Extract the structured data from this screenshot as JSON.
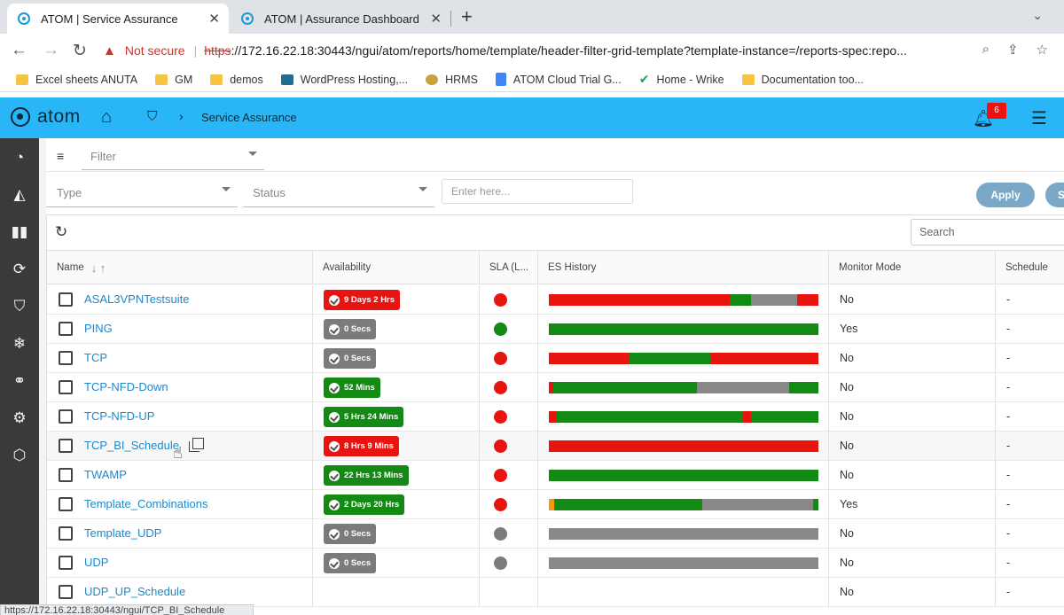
{
  "browser": {
    "tabs": [
      {
        "title": "ATOM | Service Assurance",
        "active": true
      },
      {
        "title": "ATOM | Assurance Dashboard",
        "active": false
      }
    ],
    "new_tab_label": "+",
    "close_glyph": "✕",
    "not_secure_label": "Not secure",
    "url_scheme": "https",
    "url_rest": "://172.16.22.18:30443/ngui/atom/reports/home/template/header-filter-grid-template?template-instance=/reports-spec:repo...",
    "bookmarks": [
      {
        "label": "Excel sheets ANUTA",
        "icon": "folder-icon"
      },
      {
        "label": "GM",
        "icon": "folder-icon"
      },
      {
        "label": "demos",
        "icon": "folder-icon"
      },
      {
        "label": "WordPress Hosting,...",
        "icon": "image-icon"
      },
      {
        "label": "HRMS",
        "icon": "bee-icon"
      },
      {
        "label": "ATOM Cloud Trial G...",
        "icon": "doc-icon"
      },
      {
        "label": "Home - Wrike",
        "icon": "wrike-icon"
      },
      {
        "label": "Documentation too...",
        "icon": "folder-icon"
      }
    ],
    "status_url": "https://172.16.22.18:30443/ngui/TCP_BI_Schedule"
  },
  "app": {
    "logo_text": "atom",
    "breadcrumb_title": "Service Assurance",
    "notification_count": "6",
    "accent_color": "#29b6f6"
  },
  "filters": {
    "filter_placeholder": "Filter",
    "type_placeholder": "Type",
    "status_placeholder": "Status",
    "text_placeholder": "Enter here...",
    "apply_label": "Apply",
    "second_button_label": "S",
    "search_placeholder": "Search"
  },
  "grid": {
    "columns": [
      "Name",
      "Availability",
      "SLA (L...",
      "ES History",
      "Monitor Mode",
      "Schedule"
    ],
    "rows": [
      {
        "name": "ASAL3VPNTestsuite",
        "availability": "9 Days 2 Hrs",
        "avail_color": "#e8140f",
        "sla_color": "#e8140f",
        "es": [
          [
            "#e8140f",
            67
          ],
          [
            "#138a13",
            8
          ],
          [
            "#888888",
            17
          ],
          [
            "#e8140f",
            8
          ]
        ],
        "monitor": "No",
        "schedule": "-"
      },
      {
        "name": "PING",
        "availability": "0 Secs",
        "avail_color": "#7b7b7b",
        "sla_color": "#138a13",
        "es": [
          [
            "#138a13",
            100
          ]
        ],
        "monitor": "Yes",
        "schedule": "-"
      },
      {
        "name": "TCP",
        "availability": "0 Secs",
        "avail_color": "#7b7b7b",
        "sla_color": "#e8140f",
        "es": [
          [
            "#e8140f",
            30
          ],
          [
            "#138a13",
            30
          ],
          [
            "#e8140f",
            40
          ]
        ],
        "monitor": "No",
        "schedule": "-"
      },
      {
        "name": "TCP-NFD-Down",
        "availability": "52 Mins",
        "avail_color": "#138a13",
        "sla_color": "#e8140f",
        "es": [
          [
            "#e8140f",
            1.5
          ],
          [
            "#138a13",
            53.5
          ],
          [
            "#888888",
            34
          ],
          [
            "#138a13",
            11
          ]
        ],
        "monitor": "No",
        "schedule": "-"
      },
      {
        "name": "TCP-NFD-UP",
        "availability": "5 Hrs 24 Mins",
        "avail_color": "#138a13",
        "sla_color": "#e8140f",
        "es": [
          [
            "#e8140f",
            3
          ],
          [
            "#138a13",
            69
          ],
          [
            "#e8140f",
            3
          ],
          [
            "#138a13",
            25
          ]
        ],
        "monitor": "No",
        "schedule": "-"
      },
      {
        "name": "TCP_BI_Schedule",
        "availability": "8 Hrs 9 Mins",
        "avail_color": "#e8140f",
        "sla_color": "#e8140f",
        "es": [
          [
            "#e8140f",
            100
          ]
        ],
        "monitor": "No",
        "schedule": "-"
      },
      {
        "name": "TWAMP",
        "availability": "22 Hrs 13 Mins",
        "avail_color": "#138a13",
        "sla_color": "#e8140f",
        "es": [
          [
            "#138a13",
            100
          ]
        ],
        "monitor": "No",
        "schedule": "-"
      },
      {
        "name": "Template_Combinations",
        "availability": "2 Days 20 Hrs",
        "avail_color": "#138a13",
        "sla_color": "#e8140f",
        "es": [
          [
            "#f29b0c",
            2
          ],
          [
            "#138a13",
            55
          ],
          [
            "#888888",
            41
          ],
          [
            "#138a13",
            2
          ]
        ],
        "monitor": "Yes",
        "schedule": "-"
      },
      {
        "name": "Template_UDP",
        "availability": "0 Secs",
        "avail_color": "#7b7b7b",
        "sla_color": "#7b7b7b",
        "es": [
          [
            "#888888",
            100
          ]
        ],
        "monitor": "No",
        "schedule": "-"
      },
      {
        "name": "UDP",
        "availability": "0 Secs",
        "avail_color": "#7b7b7b",
        "sla_color": "#7b7b7b",
        "es": [
          [
            "#888888",
            100
          ]
        ],
        "monitor": "No",
        "schedule": "-"
      },
      {
        "name": "UDP_UP_Schedule",
        "availability": "",
        "avail_color": "",
        "sla_color": "",
        "es": [],
        "monitor": "No",
        "schedule": "-"
      }
    ]
  },
  "nav_icons": [
    "dashboard-icon",
    "topology-icon",
    "reports-icon",
    "workflow-icon",
    "assurance-shield-icon",
    "snowflake-icon",
    "link-icon",
    "settings-gear-icon",
    "cube-icon"
  ]
}
